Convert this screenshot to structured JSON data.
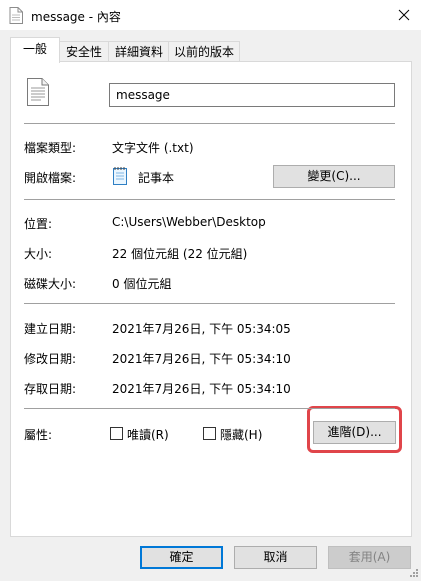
{
  "window": {
    "title": "message - 內容"
  },
  "tabs": [
    {
      "label": "一般",
      "active": true
    },
    {
      "label": "安全性",
      "active": false
    },
    {
      "label": "詳細資料",
      "active": false
    },
    {
      "label": "以前的版本",
      "active": false
    }
  ],
  "general": {
    "file_name": "message",
    "type_label": "檔案類型:",
    "type_value": "文字文件 (.txt)",
    "opens_label": "開啟檔案:",
    "opens_value": "記事本",
    "change_button": "變更(C)...",
    "location_label": "位置:",
    "location_value": "C:\\Users\\Webber\\Desktop",
    "size_label": "大小:",
    "size_value": "22 個位元組 (22 位元組)",
    "disk_size_label": "磁碟大小:",
    "disk_size_value": "0 個位元組",
    "created_label": "建立日期:",
    "created_value": "2021年7月26日, 下午 05:34:05",
    "modified_label": "修改日期:",
    "modified_value": "2021年7月26日, 下午 05:34:10",
    "accessed_label": "存取日期:",
    "accessed_value": "2021年7月26日, 下午 05:34:10",
    "attributes_label": "屬性:",
    "readonly_label": "唯讀(R)",
    "hidden_label": "隱藏(H)",
    "advanced_button": "進階(D)..."
  },
  "footer": {
    "ok": "確定",
    "cancel": "取消",
    "apply": "套用(A)"
  },
  "colors": {
    "highlight": "#e0454a",
    "focus": "#0078d7"
  }
}
